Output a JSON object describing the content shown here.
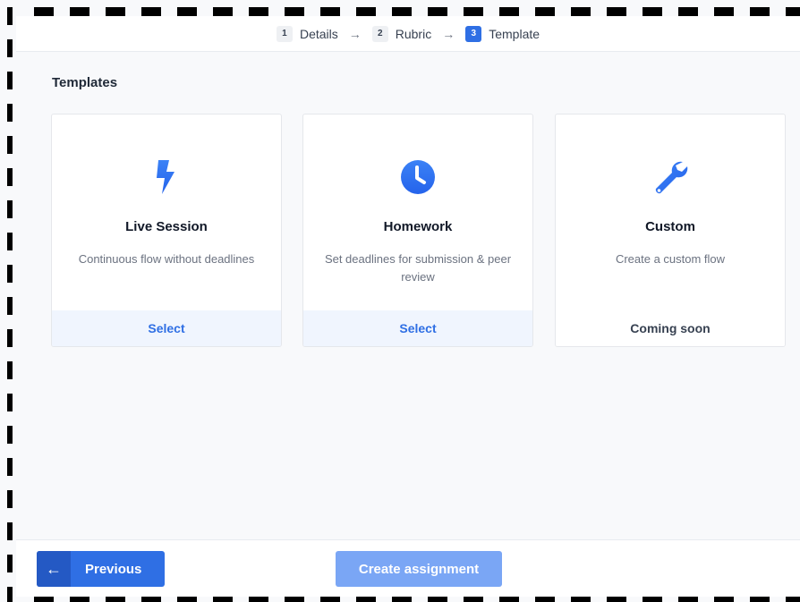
{
  "stepper": {
    "steps": [
      {
        "number": "1",
        "label": "Details"
      },
      {
        "number": "2",
        "label": "Rubric"
      },
      {
        "number": "3",
        "label": "Template"
      }
    ],
    "separator": "→",
    "active_step": 3
  },
  "section": {
    "title": "Templates"
  },
  "templates": [
    {
      "icon": "lightning-icon",
      "title": "Live Session",
      "description": "Continuous flow without deadlines",
      "action": "Select"
    },
    {
      "icon": "clock-icon",
      "title": "Homework",
      "description": "Set deadlines for submission & peer review",
      "action": "Select"
    },
    {
      "icon": "wrench-icon",
      "title": "Custom",
      "description": "Create a custom flow",
      "action": "Coming soon"
    }
  ],
  "footer": {
    "previous_label": "Previous",
    "previous_icon": "arrow-left-icon",
    "create_label": "Create assignment"
  },
  "colors": {
    "accent": "#2f6fe4",
    "accent_disabled": "#7aa6f5",
    "select_bg": "#f0f5fe"
  }
}
